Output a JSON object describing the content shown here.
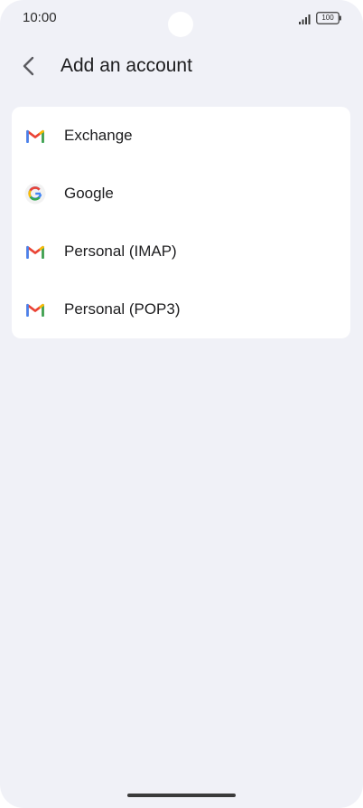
{
  "status_bar": {
    "time": "10:00",
    "battery": "100",
    "icons": [
      "signal-icon",
      "battery-icon"
    ]
  },
  "header": {
    "title": "Add an account",
    "back_icon": "chevron-left-icon"
  },
  "accounts": [
    {
      "label": "Exchange",
      "icon": "gmail-icon"
    },
    {
      "label": "Google",
      "icon": "google-icon"
    },
    {
      "label": "Personal (IMAP)",
      "icon": "gmail-icon"
    },
    {
      "label": "Personal (POP3)",
      "icon": "gmail-icon"
    }
  ],
  "colors": {
    "background": "#f0f1f7",
    "card": "#ffffff",
    "text": "#1d1d1f",
    "gmail_red": "#ea4335",
    "gmail_blue": "#4285f4",
    "gmail_green": "#34a853",
    "gmail_yellow": "#fbbc04"
  }
}
